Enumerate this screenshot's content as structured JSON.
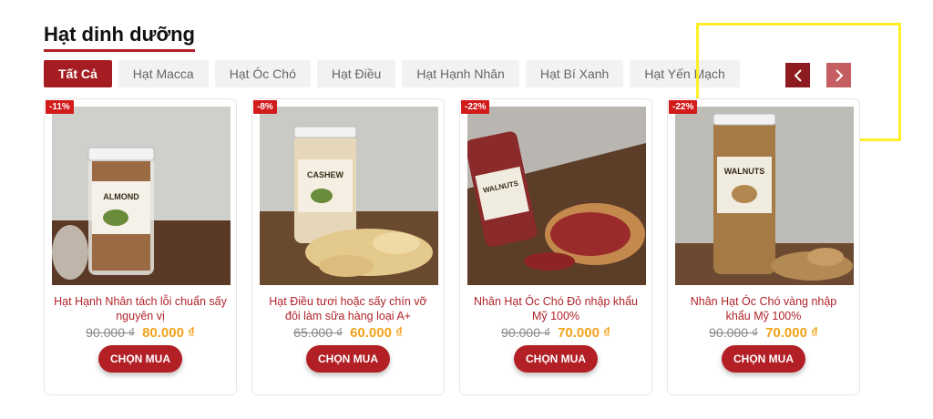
{
  "section": {
    "title": "Hạt dinh dưỡng"
  },
  "tabs": [
    {
      "label": "Tất Cả",
      "active": true
    },
    {
      "label": "Hạt Macca"
    },
    {
      "label": "Hạt Óc Chó"
    },
    {
      "label": "Hạt Điều"
    },
    {
      "label": "Hạt Hạnh Nhân"
    },
    {
      "label": "Hạt Bí Xanh"
    },
    {
      "label": "Hạt Yến Mạch"
    }
  ],
  "carousel": {
    "prev_icon": "chevron-left-icon",
    "next_icon": "chevron-right-icon"
  },
  "products": [
    {
      "discount": "-11%",
      "name": "Hạt Hạnh Nhân tách lỗi chuẩn sấy nguyên vị",
      "old_price": "90.000 ₫",
      "new_price": "80.000 ₫",
      "button": "CHỌN MUA",
      "jar_label": "ALMOND"
    },
    {
      "discount": "-8%",
      "name": "Hạt Điều tươi hoặc sấy chín vỡ đôi làm sữa hàng loại A+",
      "old_price": "65.000 ₫",
      "new_price": "60.000 ₫",
      "button": "CHỌN MUA",
      "jar_label": "CASHEW"
    },
    {
      "discount": "-22%",
      "name": "Nhân Hạt Óc Chó Đỏ nhập khẩu Mỹ 100%",
      "old_price": "90.000 ₫",
      "new_price": "70.000 ₫",
      "button": "CHỌN MUA",
      "jar_label": "WALNUTS"
    },
    {
      "discount": "-22%",
      "name": "Nhân Hạt Óc Chó vàng nhập khẩu Mỹ 100%",
      "old_price": "90.000 ₫",
      "new_price": "70.000 ₫",
      "button": "CHỌN MUA",
      "jar_label": "WALNUTS"
    }
  ],
  "colors": {
    "accent": "#a51d23",
    "price": "#f2a21b",
    "badge": "#d21b1b",
    "highlight": "#ffef27"
  }
}
